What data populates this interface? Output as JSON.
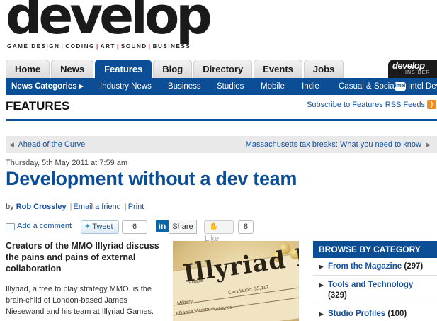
{
  "brand": {
    "wordmark": "develop",
    "tagline": [
      "GAME DESIGN",
      "CODING",
      "ART",
      "SOUND",
      "BUSINESS"
    ],
    "tagline_separator": "|",
    "accent_color": "#0b4e96"
  },
  "nav": {
    "tabs": [
      {
        "label": "Home",
        "active": false
      },
      {
        "label": "News",
        "active": false
      },
      {
        "label": "Features",
        "active": true
      },
      {
        "label": "Blog",
        "active": false
      },
      {
        "label": "Directory",
        "active": false
      },
      {
        "label": "Events",
        "active": false
      },
      {
        "label": "Jobs",
        "active": false
      }
    ],
    "insider": {
      "word": "develop",
      "sub": "INSIDER"
    }
  },
  "subnav": {
    "categories_label": "News Categories ▸",
    "items": [
      "Industry News",
      "Business",
      "Studios",
      "Mobile",
      "Indie",
      "Casual & Social",
      "Intel Dev"
    ],
    "intel_badge": "intel"
  },
  "section": {
    "title": "FEATURES",
    "rss_link": "Subscribe to Features RSS Feeds",
    "rss_icon": "rss-icon"
  },
  "pager": {
    "prev": "Ahead of the Curve",
    "next": "Massachusetts tax breaks: What you need to know"
  },
  "article": {
    "date": "Thursday, 5th May 2011 at 7:59 am",
    "headline": "Development without a dev team",
    "byline": {
      "prefix": "by",
      "author": "Rob Crossley",
      "email": "Email a friend",
      "print": "Print",
      "sep": "|"
    },
    "standfirst": "Creators of the MMO Illyriad discuss the pains and pains of external collaboration",
    "body": "Illyriad, a free to play strategy MMO, is the brain-child of London-based James Niesewand and his team at Illyriad Games."
  },
  "social": {
    "comment": "Add a comment",
    "tweet": "Tweet",
    "tweet_count": "6",
    "linkedin_icon": "in",
    "share": "Share",
    "like": "Like",
    "like_count": "8"
  },
  "image": {
    "title_text": "Illyriad He",
    "small_text": [
      "Village",
      "Circulation: 35,117",
      "Military",
      "Alliance Members",
      "Alliance"
    ]
  },
  "sidebar": {
    "heading": "BROWSE BY CATEGORY",
    "items": [
      {
        "label": "From the Magazine",
        "count": "(297)"
      },
      {
        "label": "Tools and Technology",
        "count": "(329)"
      },
      {
        "label": "Studio Profiles",
        "count": "(100)"
      }
    ]
  }
}
